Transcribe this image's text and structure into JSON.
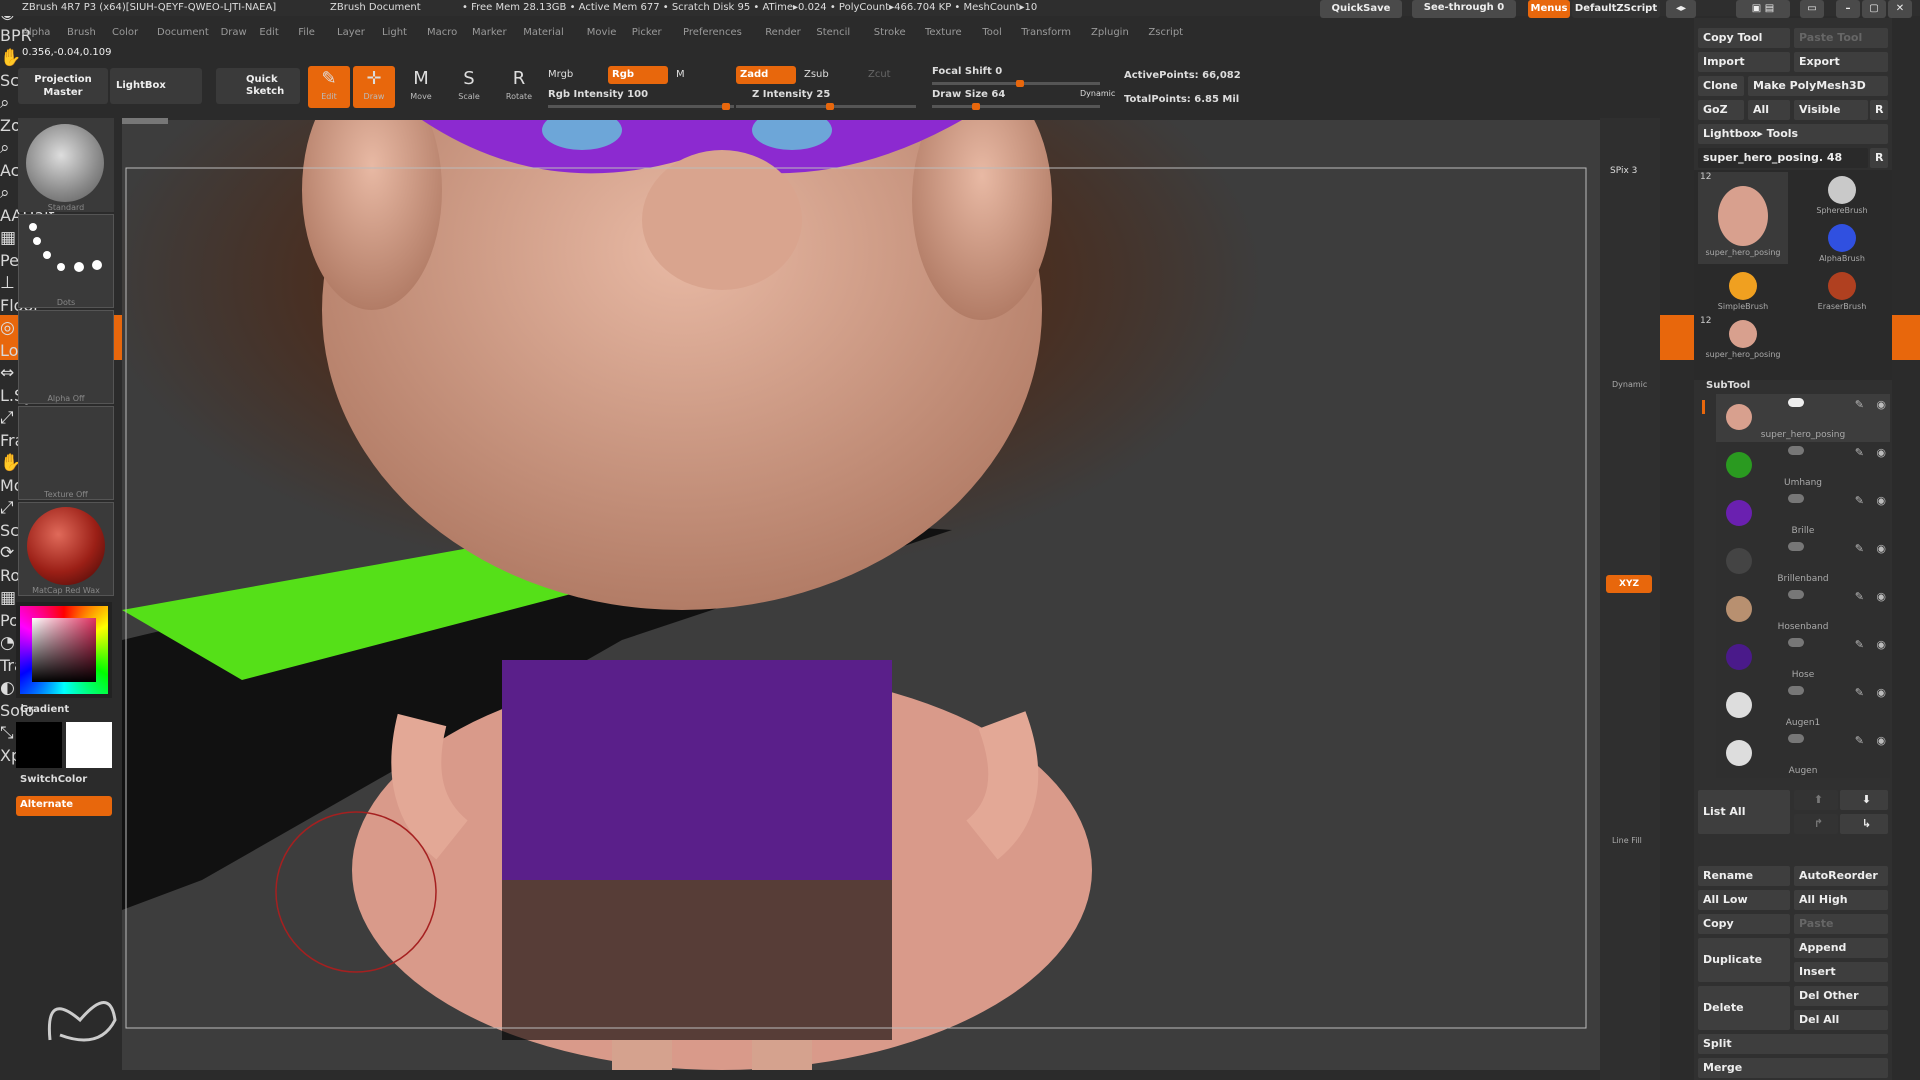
{
  "titlebar": {
    "app": "ZBrush 4R7 P3 (x64)[SIUH-QEYF-QWEO-LJTI-NAEA]",
    "doc": "ZBrush Document",
    "stats": "• Free Mem 28.13GB • Active Mem 677 • Scratch Disk 95 • ATime▸0.024 • PolyCount▸466.704 KP • MeshCount▸10",
    "quicksave": "QuickSave",
    "seethrough": "See-through  0",
    "menus": "Menus",
    "script": "DefaultZScript"
  },
  "menu": [
    "Alpha",
    "Brush",
    "Color",
    "Document",
    "Draw",
    "Edit",
    "File",
    "Layer",
    "Light",
    "Macro",
    "Marker",
    "Material",
    "Movie",
    "Picker",
    "Preferences",
    "Render",
    "Stencil",
    "Stroke",
    "Texture",
    "Tool",
    "Transform",
    "Zplugin",
    "Zscript"
  ],
  "coords": "0.356,-0.04,0.109",
  "toolbar": {
    "projection": "Projection Master",
    "lightbox": "LightBox",
    "quicksketch": "Quick Sketch",
    "edit": "Edit",
    "draw": "Draw",
    "move": "Move",
    "scale": "Scale",
    "rotate": "Rotate",
    "mrgb": "Mrgb",
    "rgb": "Rgb",
    "m": "M",
    "rgb_intensity": "Rgb Intensity 100",
    "zadd": "Zadd",
    "zsub": "Zsub",
    "zcut": "Zcut",
    "z_intensity": "Z Intensity 25",
    "focal": "Focal Shift 0",
    "drawsize": "Draw Size 64",
    "dynamic": "Dynamic",
    "active": "ActivePoints: 66,082",
    "total": "TotalPoints: 6.85 Mil"
  },
  "leftshelf": {
    "standard": "Standard",
    "dots": "Dots",
    "alpha": "Alpha Off",
    "texture": "Texture Off",
    "matcap": "MatCap Red Wax",
    "gradient": "Gradient",
    "switchcolor": "SwitchColor",
    "alternate": "Alternate"
  },
  "rightshelf": [
    "BPR",
    "Scroll",
    "Zoom",
    "Actual",
    "AAHalf",
    "Persp",
    "Floor",
    "Local",
    "L.Sym",
    "Frame",
    "Move",
    "Scale",
    "Rotate",
    "PolyF",
    "Transp",
    "Solo",
    "Xpose"
  ],
  "rightshelf_extra": {
    "spix": "SPix 3",
    "dynamic": "Dynamic",
    "linefill": "Line Fill",
    "xyz": "XYZ"
  },
  "panel": {
    "copy_tool": "Copy Tool",
    "paste_tool": "Paste Tool",
    "import": "Import",
    "export": "Export",
    "clone": "Clone",
    "make_polymesh": "Make PolyMesh3D",
    "goz": "GoZ",
    "all": "All",
    "visible": "Visible",
    "r": "R",
    "lightbox_tools": "Lightbox▸ Tools",
    "current_tool": "super_hero_posing. 48",
    "tools": [
      "super_hero_posing",
      "SphereBrush",
      "AlphaBrush",
      "SimpleBrush",
      "EraserBrush",
      "super_hero_posing"
    ],
    "tool_count": "12",
    "subtool": "SubTool",
    "subtools": [
      "super_hero_posing",
      "Umhang",
      "Brille",
      "Brillenband",
      "Hosenband",
      "Hose",
      "Augen1",
      "Augen"
    ],
    "list_all": "List All",
    "rename": "Rename",
    "autoreorder": "AutoReorder",
    "all_low": "All Low",
    "all_high": "All High",
    "copy": "Copy",
    "paste": "Paste",
    "duplicate": "Duplicate",
    "append": "Append",
    "insert": "Insert",
    "delete": "Delete",
    "del_other": "Del Other",
    "del_all": "Del All",
    "split": "Split",
    "merge": "Merge"
  },
  "colors": {
    "accent": "#e8670c",
    "bg": "#2b2b2b"
  }
}
